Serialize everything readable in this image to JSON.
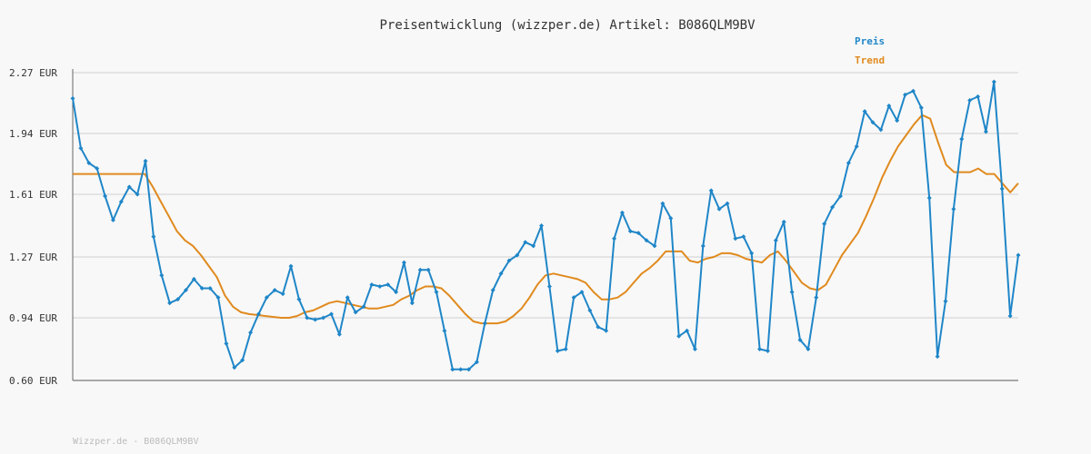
{
  "title": "Preisentwicklung (wizzper.de) Artikel: B086QLM9BV",
  "footer": "Wizzper.de - B086QLM9BV",
  "colors": {
    "price": "#1f86c8",
    "trend": "#e08a1e",
    "grid": "#dddddd",
    "axis": "#666666"
  },
  "chart_data": {
    "type": "line",
    "title": "Preisentwicklung (wizzper.de) Artikel: B086QLM9BV",
    "xlabel": "",
    "ylabel": "",
    "ylim": [
      0.6,
      2.27
    ],
    "y_ticks": [
      0.6,
      0.94,
      1.27,
      1.61,
      1.94,
      2.27
    ],
    "y_tick_labels": [
      "0.60 EUR",
      "0.94 EUR",
      "1.27 EUR",
      "1.61 EUR",
      "1.94 EUR",
      "2.27 EUR"
    ],
    "grid": true,
    "legend_position": "top-right",
    "series": [
      {
        "name": "Preis",
        "color": "#1f86c8",
        "values": [
          2.13,
          1.86,
          1.78,
          1.75,
          1.6,
          1.47,
          1.57,
          1.65,
          1.61,
          1.79,
          1.38,
          1.17,
          1.02,
          1.04,
          1.09,
          1.15,
          1.1,
          1.1,
          1.05,
          0.8,
          0.67,
          0.71,
          0.86,
          0.96,
          1.05,
          1.09,
          1.07,
          1.22,
          1.04,
          0.94,
          0.93,
          0.94,
          0.96,
          0.85,
          1.05,
          0.97,
          1.0,
          1.12,
          1.11,
          1.12,
          1.08,
          1.24,
          1.02,
          1.2,
          1.2,
          1.08,
          0.87,
          0.66,
          0.66,
          0.66,
          0.7,
          0.91,
          1.09,
          1.18,
          1.25,
          1.28,
          1.35,
          1.33,
          1.44,
          1.11,
          0.76,
          0.77,
          1.05,
          1.08,
          0.98,
          0.89,
          0.87,
          1.37,
          1.51,
          1.41,
          1.4,
          1.36,
          1.33,
          1.56,
          1.48,
          0.84,
          0.87,
          0.77,
          1.33,
          1.63,
          1.53,
          1.56,
          1.37,
          1.38,
          1.29,
          0.77,
          0.76,
          1.36,
          1.46,
          1.08,
          0.82,
          0.77,
          1.05,
          1.45,
          1.54,
          1.6,
          1.78,
          1.87,
          2.06,
          2.0,
          1.96,
          2.09,
          2.01,
          2.15,
          2.17,
          2.08,
          1.59,
          0.73,
          1.03,
          1.53,
          1.91,
          2.12,
          2.14,
          1.95,
          2.22,
          1.64,
          0.95,
          1.28
        ]
      },
      {
        "name": "Trend",
        "color": "#e08a1e",
        "values": [
          1.72,
          1.72,
          1.72,
          1.72,
          1.72,
          1.72,
          1.72,
          1.72,
          1.72,
          1.72,
          1.65,
          1.57,
          1.49,
          1.41,
          1.36,
          1.33,
          1.28,
          1.22,
          1.16,
          1.06,
          1.0,
          0.97,
          0.96,
          0.955,
          0.95,
          0.945,
          0.94,
          0.94,
          0.95,
          0.97,
          0.98,
          1.0,
          1.02,
          1.03,
          1.02,
          1.01,
          1.0,
          0.99,
          0.99,
          1.0,
          1.01,
          1.04,
          1.06,
          1.09,
          1.11,
          1.11,
          1.1,
          1.06,
          1.01,
          0.96,
          0.92,
          0.91,
          0.91,
          0.91,
          0.92,
          0.95,
          0.99,
          1.05,
          1.12,
          1.17,
          1.18,
          1.17,
          1.16,
          1.15,
          1.13,
          1.08,
          1.04,
          1.04,
          1.05,
          1.08,
          1.13,
          1.18,
          1.21,
          1.25,
          1.3,
          1.3,
          1.3,
          1.25,
          1.24,
          1.26,
          1.27,
          1.29,
          1.29,
          1.28,
          1.26,
          1.25,
          1.24,
          1.28,
          1.3,
          1.25,
          1.19,
          1.13,
          1.1,
          1.09,
          1.12,
          1.2,
          1.28,
          1.34,
          1.4,
          1.49,
          1.59,
          1.7,
          1.79,
          1.87,
          1.93,
          1.99,
          2.04,
          2.02,
          1.89,
          1.77,
          1.73,
          1.73,
          1.73,
          1.75,
          1.72,
          1.72,
          1.67,
          1.62,
          1.67
        ]
      }
    ]
  }
}
